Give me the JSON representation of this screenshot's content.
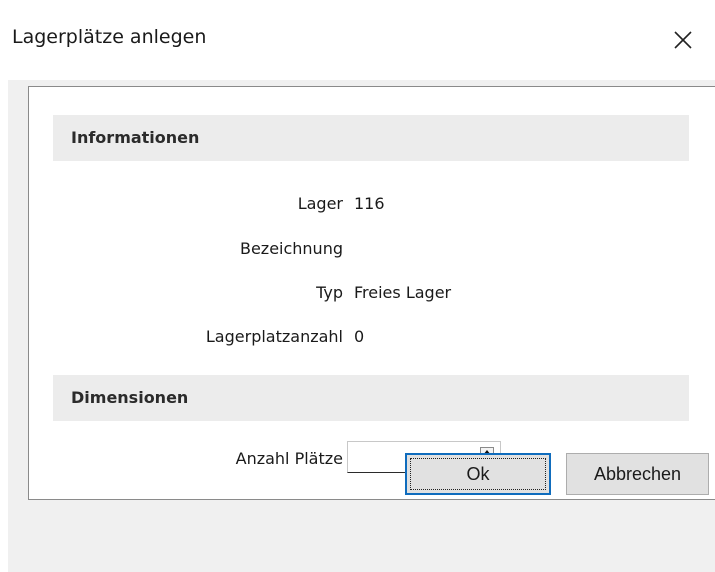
{
  "window": {
    "title": "Lagerplätze anlegen"
  },
  "sections": {
    "informationen": {
      "header": "Informationen",
      "fields": [
        {
          "label": "Lager",
          "value": "116"
        },
        {
          "label": "Bezeichnung",
          "value": ""
        },
        {
          "label": "Typ",
          "value": "Freies Lager"
        },
        {
          "label": "Lagerplatzanzahl",
          "value": "0"
        }
      ]
    },
    "dimensionen": {
      "header": "Dimensionen",
      "anzahl_label": "Anzahl Plätze",
      "anzahl_value": ""
    }
  },
  "buttons": {
    "ok": "Ok",
    "cancel": "Abbrechen"
  },
  "icons": {
    "close": "close-icon",
    "spin_up": "chevron-up-icon",
    "spin_down": "chevron-down-icon"
  },
  "colors": {
    "section_header_bg": "#ececec",
    "dialog_bg": "#f0f0f0",
    "focus_border": "#0f6cbd"
  }
}
